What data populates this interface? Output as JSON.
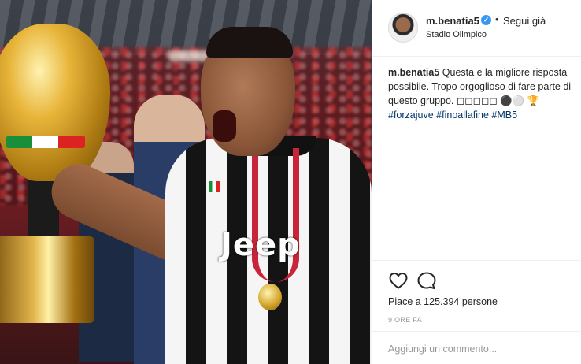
{
  "post": {
    "photo": {
      "description_alt": "",
      "sponsor_text": "Jeep"
    },
    "header": {
      "username": "m.benatia5",
      "verified": true,
      "dot": "•",
      "follow_label": "Segui già",
      "location": "Stadio Olimpico",
      "avatar_icon": "avatar-icon"
    },
    "caption": {
      "username": "m.benatia5",
      "text": "Questa e la migliore risposta possibile. Tropo orgoglioso di fare parte di questo gruppo. ◻◻◻◻◻ ⚫⚪ 🏆",
      "hashtags": [
        "#forzajuve",
        "#finoallafine",
        "#MB5"
      ]
    },
    "actions": {
      "like_icon": "heart-icon",
      "comment_icon": "comment-icon"
    },
    "likes_text": "Piace a 125.394 persone",
    "time_text": "9 ORE FA",
    "comment_placeholder": "Aggiungi un commento...",
    "colors": {
      "verified_blue": "#3897f0",
      "hashtag_blue": "#003569",
      "divider": "#efefef",
      "muted": "#999999"
    }
  }
}
